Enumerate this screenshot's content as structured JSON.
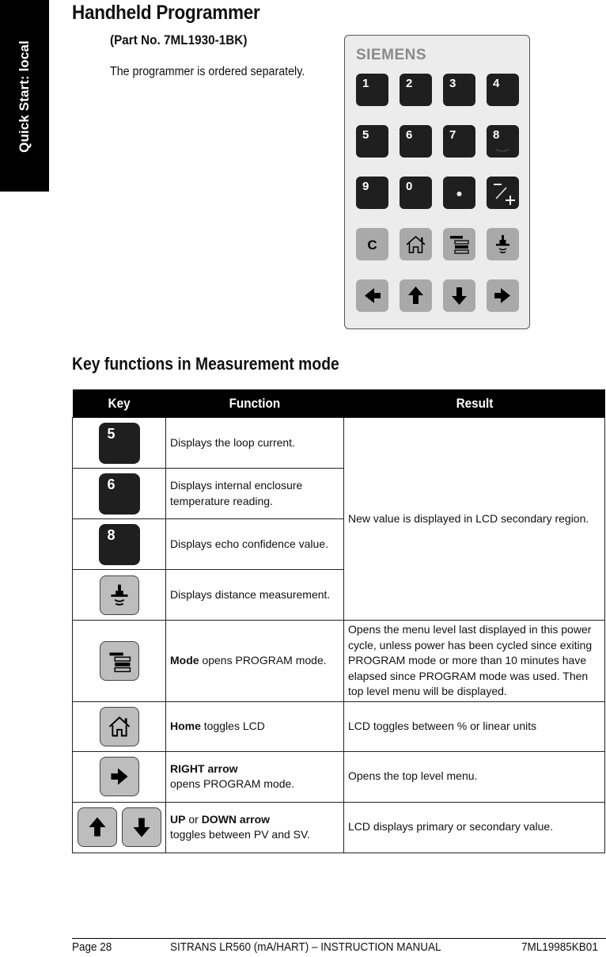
{
  "side_tab": {
    "label": "Quick Start: local"
  },
  "header": {
    "title": "Handheld Programmer",
    "part_no": "(Part No. 7ML1930-1BK)",
    "note": "The programmer is ordered separately."
  },
  "device": {
    "brand": "SIEMENS",
    "keys": [
      {
        "label": "1",
        "style": "dark",
        "icon": null
      },
      {
        "label": "2",
        "style": "dark",
        "icon": null
      },
      {
        "label": "3",
        "style": "dark",
        "icon": null
      },
      {
        "label": "4",
        "style": "dark",
        "icon": null
      },
      {
        "label": "5",
        "style": "dark",
        "icon": null
      },
      {
        "label": "6",
        "style": "dark",
        "icon": null
      },
      {
        "label": "7",
        "style": "dark",
        "icon": null
      },
      {
        "label": "8",
        "style": "dark",
        "icon": "echo-icon"
      },
      {
        "label": "9",
        "style": "dark",
        "icon": null
      },
      {
        "label": "0",
        "style": "dark",
        "icon": null
      },
      {
        "label": "",
        "style": "dark",
        "icon": "decimal-point-icon"
      },
      {
        "label": "",
        "style": "dark",
        "icon": "plus-minus-icon"
      },
      {
        "label": "C",
        "style": "light",
        "icon": "clear-icon"
      },
      {
        "label": "",
        "style": "light",
        "icon": "home-icon"
      },
      {
        "label": "",
        "style": "light",
        "icon": "mode-icon"
      },
      {
        "label": "",
        "style": "light",
        "icon": "transducer-icon"
      },
      {
        "label": "",
        "style": "light",
        "icon": "arrow-left-icon"
      },
      {
        "label": "",
        "style": "light",
        "icon": "arrow-up-icon"
      },
      {
        "label": "",
        "style": "light",
        "icon": "arrow-down-icon"
      },
      {
        "label": "",
        "style": "light",
        "icon": "arrow-right-icon"
      }
    ]
  },
  "section": {
    "title": "Key functions in Measurement mode"
  },
  "table": {
    "headers": {
      "key": "Key",
      "function": "Function",
      "result": "Result"
    },
    "shared_result": "New value is displayed in LCD secondary region.",
    "rows": [
      {
        "key": "5",
        "key_icon": "key-5",
        "function": "Displays the loop current."
      },
      {
        "key": "6",
        "key_icon": "key-6",
        "function": "Displays internal enclosure temperature reading."
      },
      {
        "key": "8",
        "key_icon": "key-8",
        "function": "Displays echo confidence value."
      },
      {
        "key": "",
        "key_icon": "transducer-icon",
        "function": "Displays distance measurement."
      },
      {
        "key": "",
        "key_icon": "mode-icon",
        "function_bold": "Mode",
        "function": " opens PROGRAM mode.",
        "result": "Opens the menu level last displayed in this power cycle, unless power has been cycled since exiting PROGRAM mode or more than 10 minutes have elapsed since PROGRAM mode was used. Then top level menu will be displayed."
      },
      {
        "key": "",
        "key_icon": "home-icon",
        "function_bold": "Home",
        "function": " toggles LCD",
        "result": "LCD toggles between % or linear units"
      },
      {
        "key": "",
        "key_icon": "arrow-right-icon",
        "function_bold": "RIGHT arrow",
        "function": "opens PROGRAM mode.",
        "result": "Opens the top level menu."
      },
      {
        "key": "",
        "key_icon": "arrow-up-down-icons",
        "function_bold": "UP",
        "function_or": " or ",
        "function_bold2": "DOWN arrow",
        "function": "toggles between PV and SV.",
        "result": "LCD displays primary or secondary value."
      }
    ]
  },
  "footer": {
    "page": "Page 28",
    "manual": "SITRANS LR560 (mA/HART) – INSTRUCTION MANUAL",
    "doc_no": "7ML19985KB01"
  }
}
